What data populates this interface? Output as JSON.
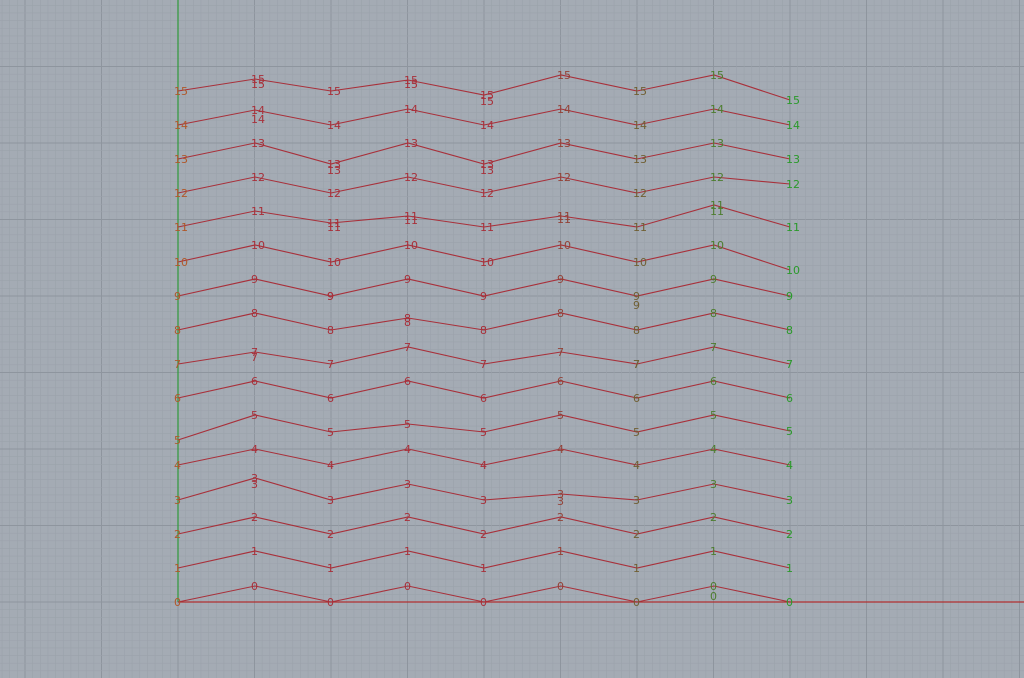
{
  "viewport": {
    "name": "Top viewport",
    "colors": {
      "background": "#a4abb4",
      "grid_minor": "#9ba2ab",
      "grid_major": "#8e959e",
      "x_axis": "#b03030",
      "y_axis": "#2f9a3a",
      "polyline": "#a8303a",
      "label_start": "#b0582a",
      "label_end": "#2a9a2a"
    }
  },
  "rows": [
    {
      "label": "0"
    },
    {
      "label": "1"
    },
    {
      "label": "2"
    },
    {
      "label": "3"
    },
    {
      "label": "4"
    },
    {
      "label": "5"
    },
    {
      "label": "6"
    },
    {
      "label": "7"
    },
    {
      "label": "8"
    },
    {
      "label": "9"
    },
    {
      "label": "10"
    },
    {
      "label": "11"
    },
    {
      "label": "12"
    },
    {
      "label": "13"
    },
    {
      "label": "14"
    },
    {
      "label": "15"
    }
  ]
}
